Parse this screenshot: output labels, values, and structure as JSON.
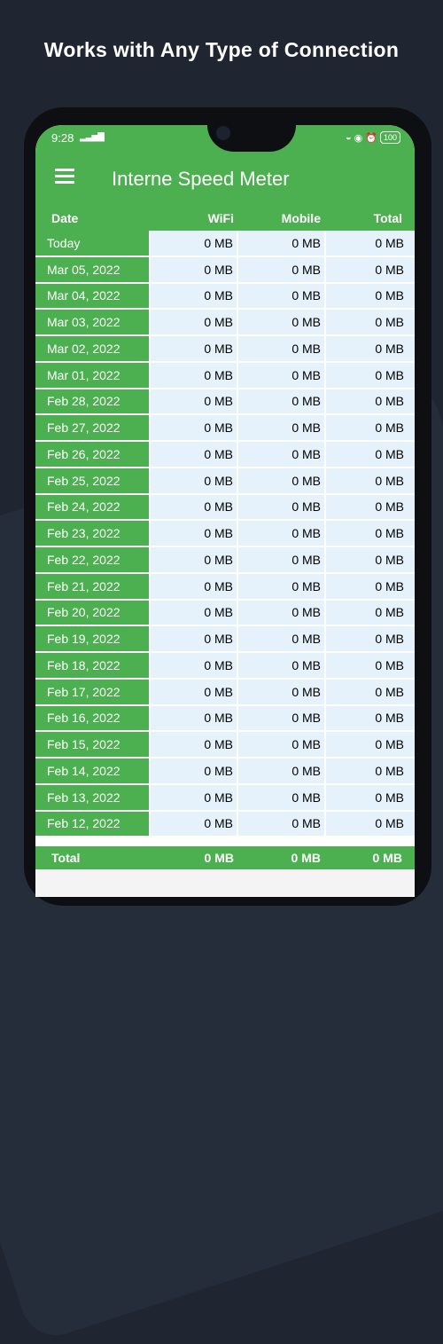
{
  "promo": {
    "headline": "Works with Any Type of Connection"
  },
  "status": {
    "time": "9:28",
    "battery": "100"
  },
  "appbar": {
    "title": "Interne Speed Meter"
  },
  "table": {
    "headers": {
      "date": "Date",
      "wifi": "WiFi",
      "mobile": "Mobile",
      "total": "Total"
    },
    "rows": [
      {
        "date": "Today",
        "wifi": "0 MB",
        "mobile": "0 MB",
        "total": "0 MB"
      },
      {
        "date": "Mar 05, 2022",
        "wifi": "0 MB",
        "mobile": "0 MB",
        "total": "0 MB"
      },
      {
        "date": "Mar 04, 2022",
        "wifi": "0 MB",
        "mobile": "0 MB",
        "total": "0 MB"
      },
      {
        "date": "Mar 03, 2022",
        "wifi": "0 MB",
        "mobile": "0 MB",
        "total": "0 MB"
      },
      {
        "date": "Mar 02, 2022",
        "wifi": "0 MB",
        "mobile": "0 MB",
        "total": "0 MB"
      },
      {
        "date": "Mar 01, 2022",
        "wifi": "0 MB",
        "mobile": "0 MB",
        "total": "0 MB"
      },
      {
        "date": "Feb 28, 2022",
        "wifi": "0 MB",
        "mobile": "0 MB",
        "total": "0 MB"
      },
      {
        "date": "Feb 27, 2022",
        "wifi": "0 MB",
        "mobile": "0 MB",
        "total": "0 MB"
      },
      {
        "date": "Feb 26, 2022",
        "wifi": "0 MB",
        "mobile": "0 MB",
        "total": "0 MB"
      },
      {
        "date": "Feb 25, 2022",
        "wifi": "0 MB",
        "mobile": "0 MB",
        "total": "0 MB"
      },
      {
        "date": "Feb 24, 2022",
        "wifi": "0 MB",
        "mobile": "0 MB",
        "total": "0 MB"
      },
      {
        "date": "Feb 23, 2022",
        "wifi": "0 MB",
        "mobile": "0 MB",
        "total": "0 MB"
      },
      {
        "date": "Feb 22, 2022",
        "wifi": "0 MB",
        "mobile": "0 MB",
        "total": "0 MB"
      },
      {
        "date": "Feb 21, 2022",
        "wifi": "0 MB",
        "mobile": "0 MB",
        "total": "0 MB"
      },
      {
        "date": "Feb 20, 2022",
        "wifi": "0 MB",
        "mobile": "0 MB",
        "total": "0 MB"
      },
      {
        "date": "Feb 19, 2022",
        "wifi": "0 MB",
        "mobile": "0 MB",
        "total": "0 MB"
      },
      {
        "date": "Feb 18, 2022",
        "wifi": "0 MB",
        "mobile": "0 MB",
        "total": "0 MB"
      },
      {
        "date": "Feb 17, 2022",
        "wifi": "0 MB",
        "mobile": "0 MB",
        "total": "0 MB"
      },
      {
        "date": "Feb 16, 2022",
        "wifi": "0 MB",
        "mobile": "0 MB",
        "total": "0 MB"
      },
      {
        "date": "Feb 15, 2022",
        "wifi": "0 MB",
        "mobile": "0 MB",
        "total": "0 MB"
      },
      {
        "date": "Feb 14, 2022",
        "wifi": "0 MB",
        "mobile": "0 MB",
        "total": "0 MB"
      },
      {
        "date": "Feb 13, 2022",
        "wifi": "0 MB",
        "mobile": "0 MB",
        "total": "0 MB"
      },
      {
        "date": "Feb 12, 2022",
        "wifi": "0 MB",
        "mobile": "0 MB",
        "total": "0 MB"
      }
    ],
    "footer": {
      "label": "Total",
      "wifi": "0 MB",
      "mobile": "0 MB",
      "total": "0 MB"
    }
  },
  "colors": {
    "primary": "#4caf50",
    "cell_bg": "#e5f2fb",
    "page_bg": "#1f2531"
  }
}
